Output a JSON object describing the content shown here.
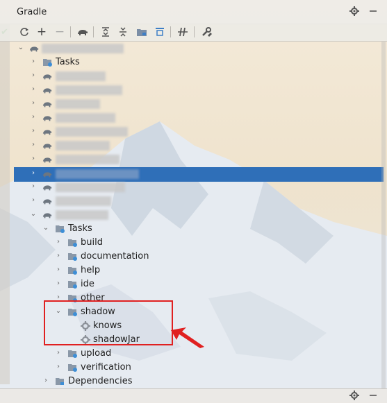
{
  "window": {
    "title": "Gradle"
  },
  "header_icons": [
    "gear-icon",
    "minus-icon"
  ],
  "toolbar": {
    "buttons": [
      {
        "name": "refresh-icon",
        "glyph": "⟳"
      },
      {
        "name": "add-icon",
        "glyph": "+"
      },
      {
        "name": "remove-icon",
        "glyph": "−"
      },
      {
        "name": "execute-task-icon",
        "glyph": "🐘"
      },
      {
        "name": "expand-all-icon",
        "glyph": "⇞"
      },
      {
        "name": "collapse-all-icon",
        "glyph": "⇟"
      },
      {
        "name": "group-modules-icon",
        "glyph": "▦"
      },
      {
        "name": "dependencies-icon",
        "glyph": "⊤"
      },
      {
        "name": "toggle-offline-icon",
        "glyph": "⫽"
      },
      {
        "name": "build-tool-settings-icon",
        "glyph": "🔧"
      }
    ]
  },
  "tree": {
    "root_tasks_label": "Tasks",
    "module_tasks_label": "Tasks",
    "task_groups": [
      "build",
      "documentation",
      "help",
      "ide",
      "other"
    ],
    "shadow": {
      "label": "shadow",
      "children": [
        "knows",
        "shadowJar"
      ]
    },
    "after_groups": [
      "upload",
      "verification"
    ],
    "dependencies_label": "Dependencies"
  },
  "colors": {
    "selection": "#2f6fb8",
    "highlight_box": "#e02020"
  }
}
